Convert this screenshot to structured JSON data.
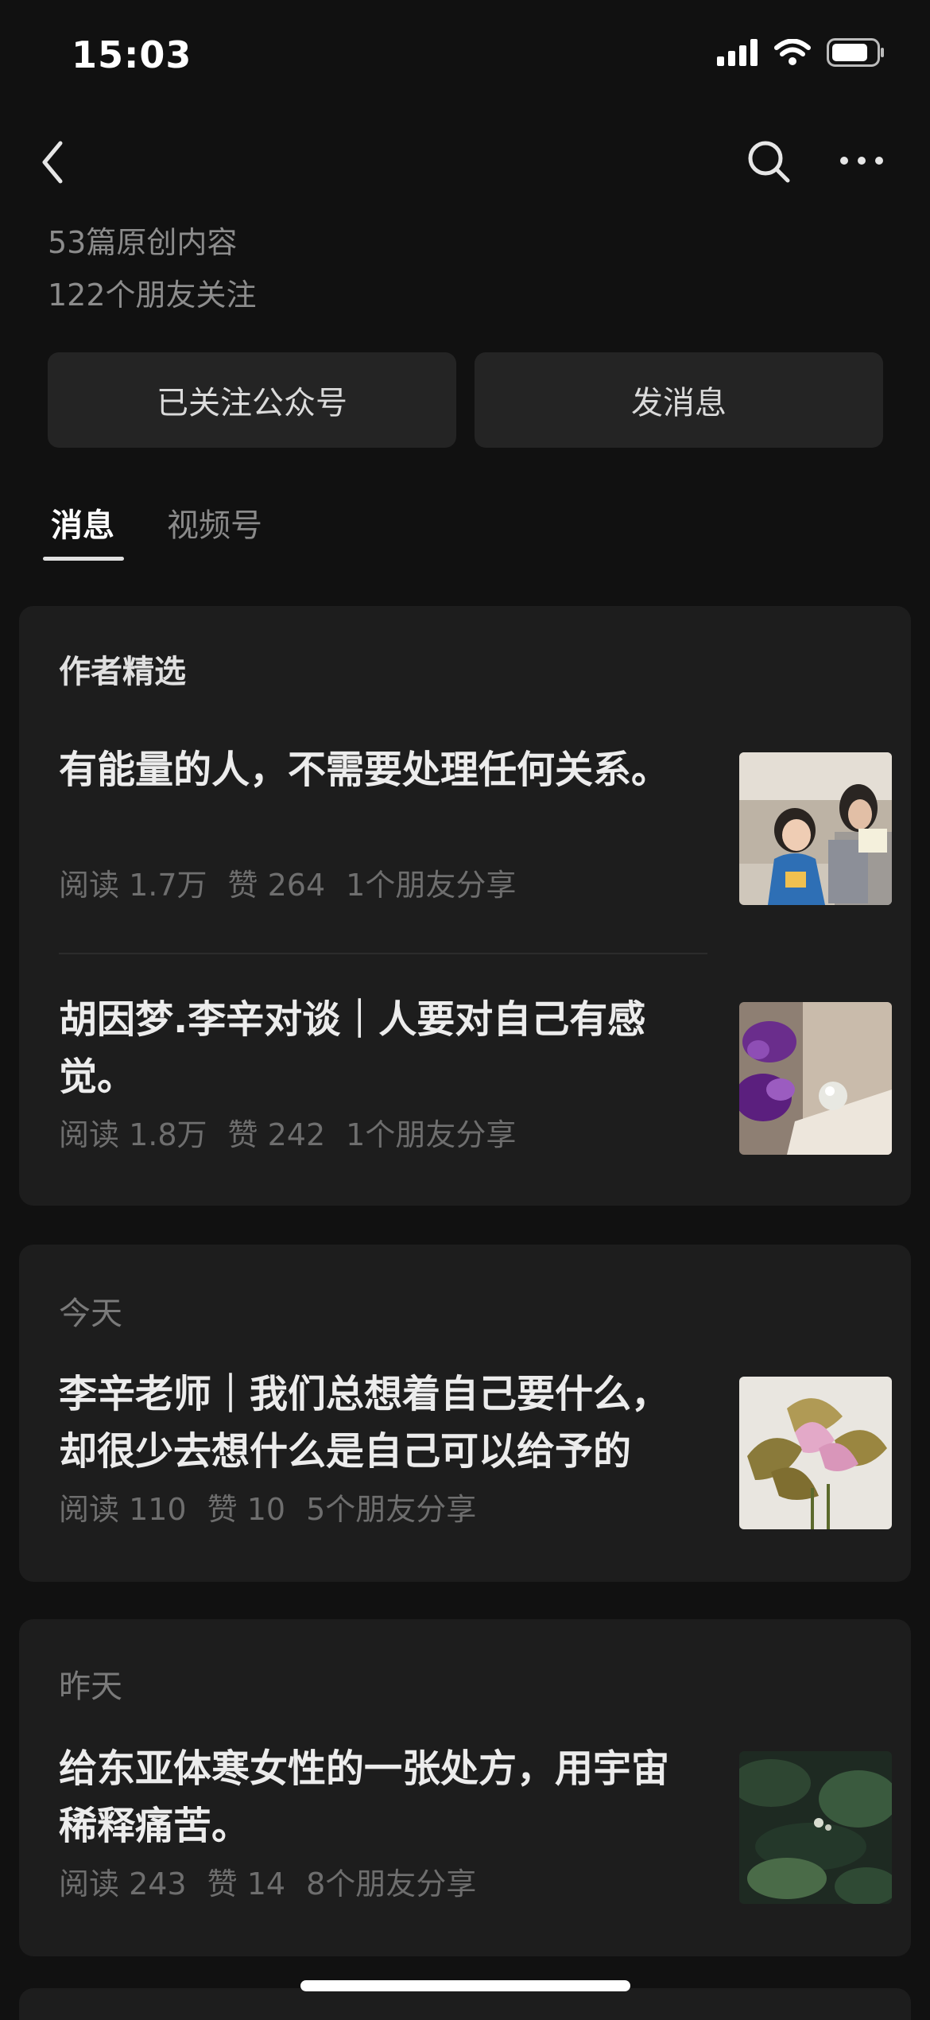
{
  "status_bar": {
    "time": "15:03",
    "icons": [
      "cellular-signal-icon",
      "wifi-icon",
      "battery-icon"
    ]
  },
  "nav": {
    "icons": [
      "back-chevron-icon",
      "search-icon",
      "more-icon"
    ]
  },
  "profile": {
    "original_count": "53篇原创内容",
    "friends_following": "122个朋友关注"
  },
  "actions": {
    "followed_label": "已关注公众号",
    "message_label": "发消息"
  },
  "tabs": [
    {
      "label": "消息",
      "active": true
    },
    {
      "label": "视频号",
      "active": false
    }
  ],
  "author_picks": {
    "heading": "作者精选",
    "articles": [
      {
        "title": "有能量的人，不需要处理任何关系。",
        "reads": "阅读 1.7万",
        "likes": "赞 264",
        "shares": "1个朋友分享",
        "thumb_icon": "photo-child-and-woman-thumbnail"
      },
      {
        "title": "胡因梦.李辛对谈｜人要对自己有感觉。",
        "reads": "阅读 1.8万",
        "likes": "赞 242",
        "shares": "1个朋友分享",
        "thumb_icon": "photo-purple-flower-thumbnail"
      }
    ]
  },
  "today": {
    "heading": "今天",
    "article": {
      "title": "李辛老师｜我们总想着自己要什么，却很少去想什么是自己可以给予的",
      "reads": "阅读 110",
      "likes": "赞 10",
      "shares": "5个朋友分享",
      "thumb_icon": "photo-lilies-thumbnail"
    }
  },
  "yesterday": {
    "heading": "昨天",
    "article": {
      "title": "给东亚体寒女性的一张处方，用宇宙稀释痛苦。",
      "reads": "阅读 243",
      "likes": "赞 14",
      "shares": "8个朋友分享",
      "thumb_icon": "photo-green-foliage-thumbnail"
    }
  },
  "colors": {
    "background": "#111111",
    "card": "#1D1D1D",
    "button": "#242424",
    "text_primary": "#ECECEC",
    "text_muted": "#6E6E6E"
  }
}
